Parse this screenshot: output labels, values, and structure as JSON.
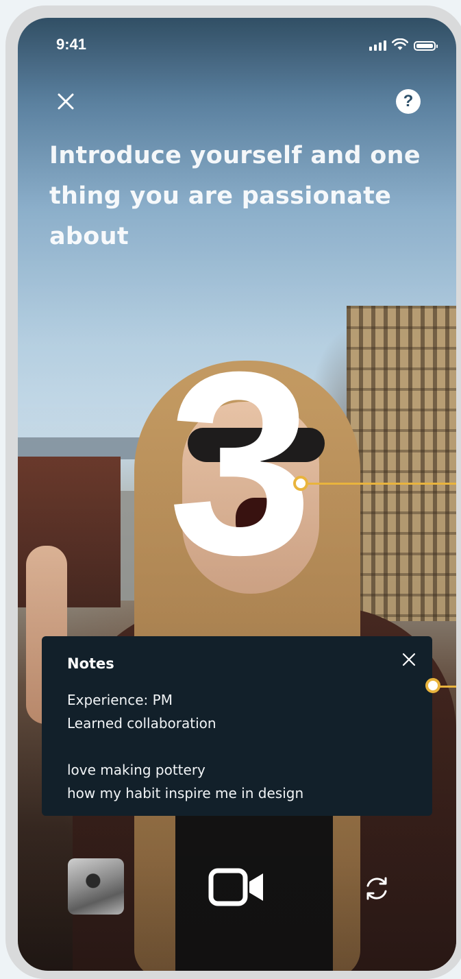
{
  "status_bar": {
    "time": "9:41",
    "icons": [
      "signal-icon",
      "wifi-icon",
      "battery-icon"
    ]
  },
  "header": {
    "close_icon": "close-icon",
    "help_label": "?"
  },
  "prompt": {
    "text": "Introduce yourself and one thing you are passionate about"
  },
  "countdown": {
    "value": "3"
  },
  "notes": {
    "title": "Notes",
    "lines": [
      "Experience: PM",
      "Learned collaboration",
      "",
      "love making pottery",
      "how my habit inspire me in design"
    ]
  },
  "controls": {
    "gallery_icon": "gallery-thumbnail",
    "record_icon": "video-camera-icon",
    "flip_icon": "flip-camera-icon"
  },
  "colors": {
    "annotation_accent": "#e9b43d",
    "notes_background": "#12202a",
    "phone_frame": "#d9dadb",
    "page_background": "#eef3f6"
  }
}
